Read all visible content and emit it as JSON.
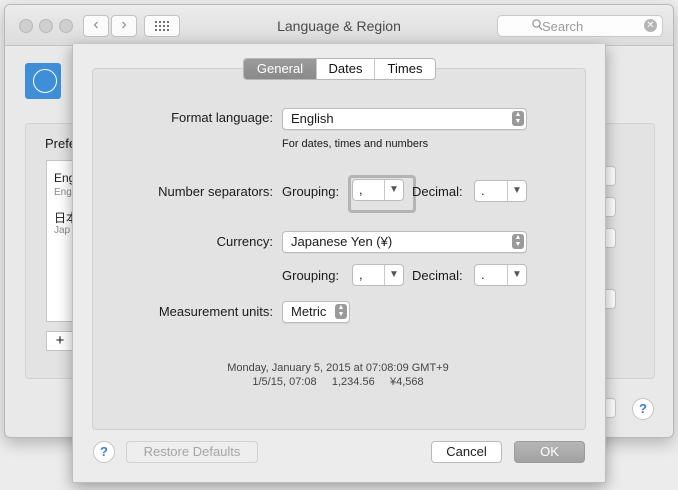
{
  "window": {
    "title": "Language & Region",
    "search_placeholder": "Search",
    "flag_glyph": "🇺🇳",
    "header_tail": ",",
    "pref_label": "Prefe",
    "pref_items": [
      {
        "title": "Eng",
        "subtitle": "Eng"
      },
      {
        "title": "日本",
        "subtitle": "Jap"
      }
    ],
    "add_label": "+",
    "help_label": "?"
  },
  "sheet": {
    "tabs": [
      {
        "label": "General",
        "active": true
      },
      {
        "label": "Dates",
        "active": false
      },
      {
        "label": "Times",
        "active": false
      }
    ],
    "format_language": {
      "label": "Format language:",
      "value": "English",
      "note": "For dates, times and numbers"
    },
    "number_separators": {
      "label": "Number separators:",
      "grouping_label": "Grouping:",
      "grouping_value": ",",
      "decimal_label": "Decimal:",
      "decimal_value": "."
    },
    "currency": {
      "label": "Currency:",
      "value": "Japanese Yen (¥)",
      "grouping_label": "Grouping:",
      "grouping_value": ",",
      "decimal_label": "Decimal:",
      "decimal_value": "."
    },
    "measurement": {
      "label": "Measurement units:",
      "value": "Metric"
    },
    "sample_line1": "Monday, January 5, 2015 at 07:08:09 GMT+9",
    "sample_line2": "1/5/15, 07:08     1,234.56     ¥4,568",
    "help_label": "?",
    "restore_label": "Restore Defaults",
    "cancel_label": "Cancel",
    "ok_label": "OK"
  }
}
